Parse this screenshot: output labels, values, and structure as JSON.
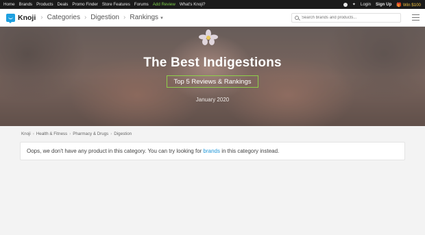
{
  "topbar": {
    "links": [
      "Home",
      "Brands",
      "Products",
      "Deals",
      "Promo Finder",
      "Store Features",
      "Forums"
    ],
    "add_review": "Add Review",
    "whats_knoji": "What's Knoji?",
    "login": "Login",
    "signup": "Sign Up",
    "win": "Win $100",
    "accent_green": "#7fd14b",
    "win_color": "#f5c542"
  },
  "header": {
    "brand": "Knoji",
    "breadcrumbs": [
      "Categories",
      "Digestion",
      "Rankings"
    ],
    "search_placeholder": "Search brands and products...",
    "brand_color": "#1ea0e0"
  },
  "hero": {
    "title": "The Best Indigestions",
    "badge": "Top 5 Reviews & Rankings",
    "date": "January 2020"
  },
  "breadcrumb": {
    "items": [
      "Knoji",
      "Health & Fitness",
      "Pharmacy & Drugs",
      "Digestion"
    ]
  },
  "message": {
    "before": "Oops, we don't have any product in this category. You can try looking for ",
    "link": "brands",
    "after": " in this category instead.",
    "link_color": "#1e96d8"
  }
}
